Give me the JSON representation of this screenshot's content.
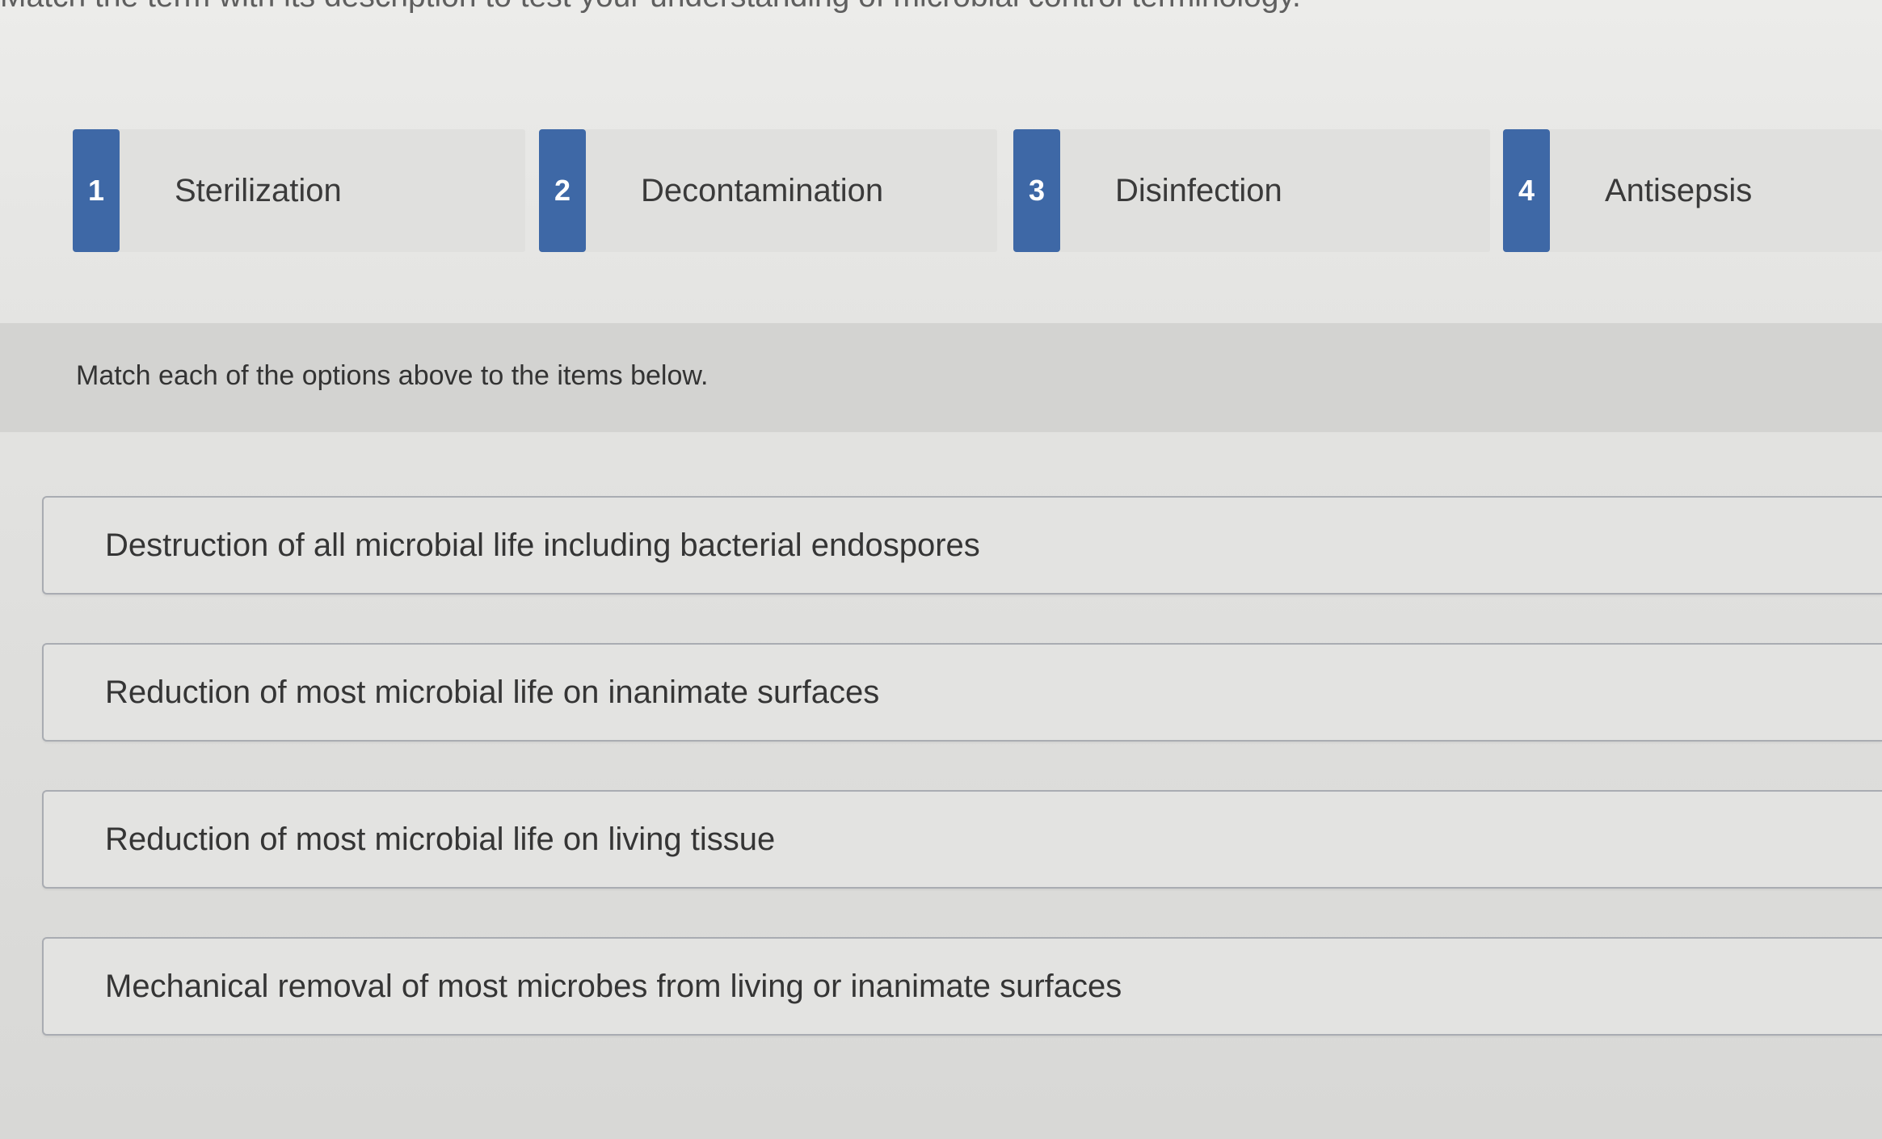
{
  "instruction": "Match the term with its description to test your understanding of microbial control terminology.",
  "options": [
    {
      "number": "1",
      "term": "Sterilization"
    },
    {
      "number": "2",
      "term": "Decontamination"
    },
    {
      "number": "3",
      "term": "Disinfection"
    },
    {
      "number": "4",
      "term": "Antisepsis"
    }
  ],
  "prompt": "Match each of the options above to the items below.",
  "targets": [
    {
      "description": "Destruction of all microbial life including bacterial endospores"
    },
    {
      "description": "Reduction of most microbial life on inanimate surfaces"
    },
    {
      "description": "Reduction of most microbial life on living tissue"
    },
    {
      "description": "Mechanical removal of most microbes from living or inanimate surfaces"
    }
  ],
  "colors": {
    "number_badge": "#3e68a6",
    "option_background": "#e0e0de",
    "target_border": "#a9acb2"
  }
}
